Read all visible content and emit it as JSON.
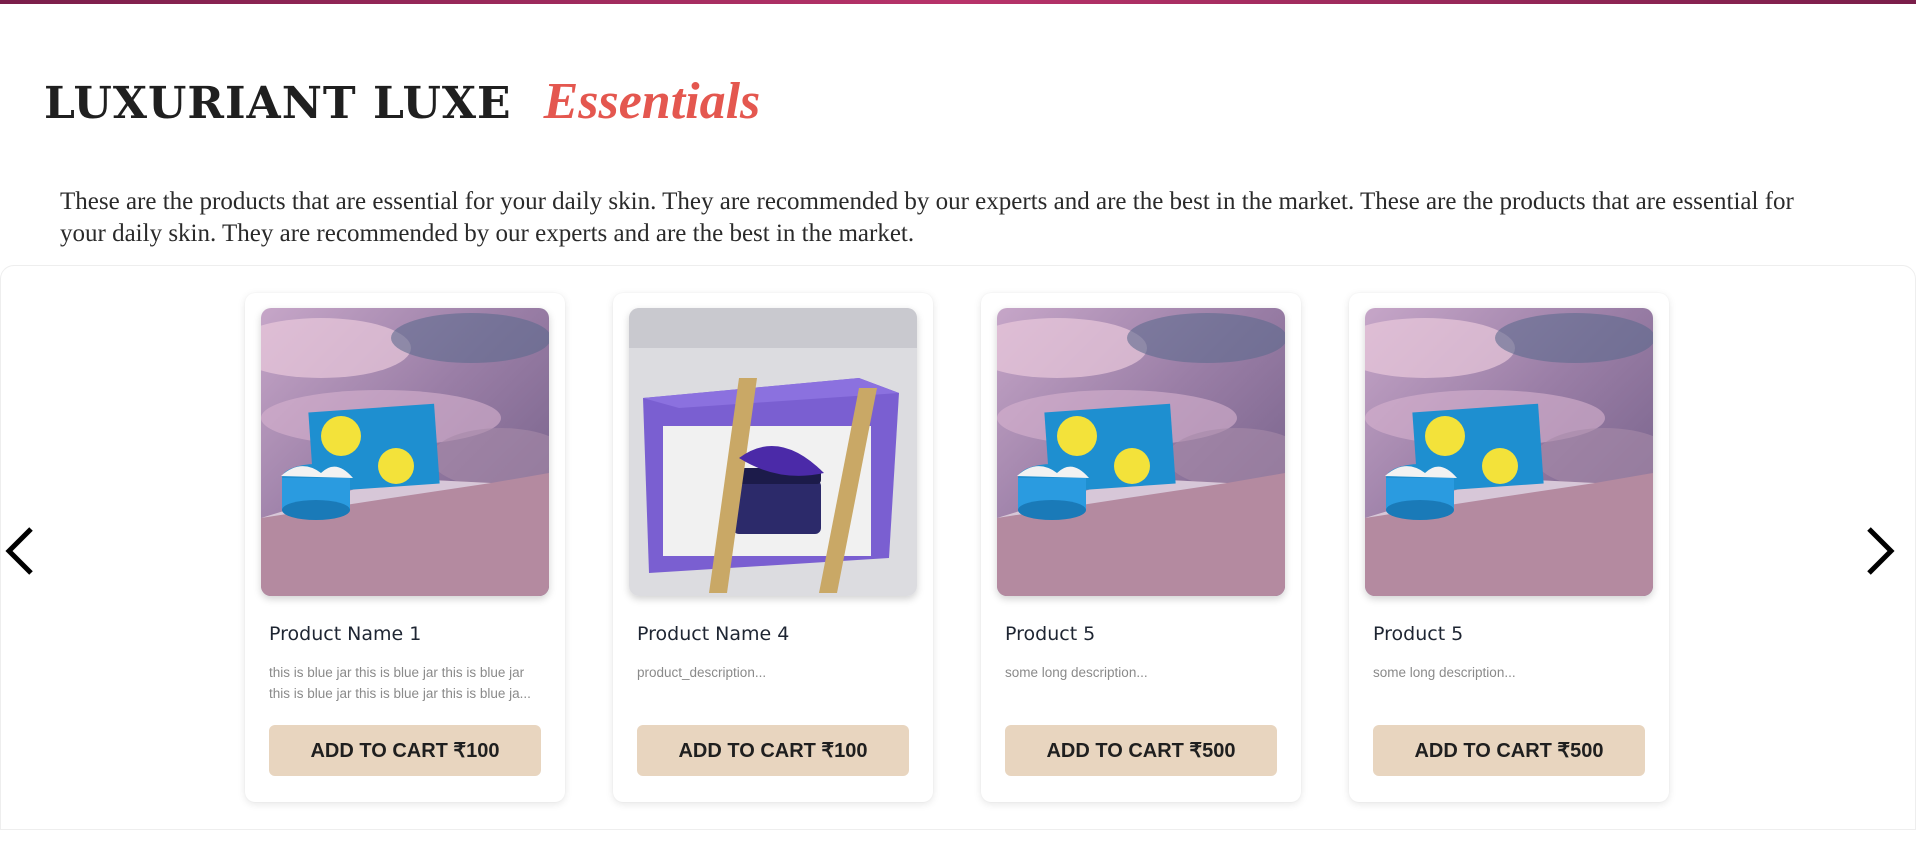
{
  "header": {
    "title_main": "LUXURIANT LUXE",
    "title_accent": "Essentials"
  },
  "intro": {
    "text": "These are the products that are essential for your daily skin. They are recommended by our experts and are the best in the market. These are the products that are essential for your daily skin. They are recommended by our experts and are the best in the market."
  },
  "carousel": {
    "prev_icon": "chevron-left-icon",
    "next_icon": "chevron-right-icon",
    "products": [
      {
        "name": "Product Name 1",
        "description": "this is blue jar this is blue jar this is blue jar this is blue jar this is blue jar this is blue ja...",
        "button_label": "ADD TO CART ₹100",
        "image": "blue-jar-clouds"
      },
      {
        "name": "Product Name 4",
        "description": "product_description...",
        "button_label": "ADD TO CART ₹100",
        "image": "purple-gift-box"
      },
      {
        "name": "Product 5",
        "description": "some long description...",
        "button_label": "ADD TO CART ₹500",
        "image": "blue-jar-clouds"
      },
      {
        "name": "Product 5",
        "description": "some long description...",
        "button_label": "ADD TO CART ₹500",
        "image": "blue-jar-clouds"
      }
    ]
  },
  "colors": {
    "accent": "#e4574f",
    "button_bg": "#e8d5bf",
    "top_bar": "#b8336a"
  }
}
